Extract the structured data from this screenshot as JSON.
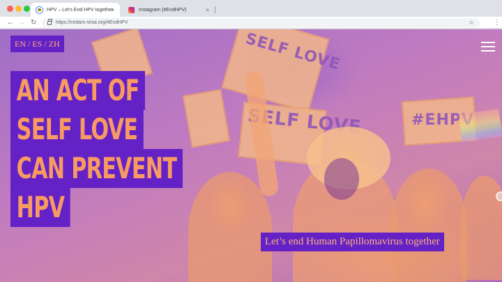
{
  "browser": {
    "tabs": [
      {
        "title": "HPV – Let’s End HPV together",
        "active": true,
        "favicon": "chrome-favicon"
      },
      {
        "title": "Instagram (#EndHPV)",
        "active": false,
        "favicon": "instagram-favicon"
      }
    ],
    "tab_close_glyph": "×",
    "address": "https://cedars-sinai.org/#EndHPV",
    "icons": {
      "back": "←",
      "forward": "→",
      "reload": "↻",
      "star": "☆",
      "menu": "⋮"
    }
  },
  "page": {
    "language_switcher": "EN / ES / ZH",
    "headline_lines": [
      "AN ACT OF",
      "SELF LOVE",
      "CAN PREVENT",
      "HPV"
    ],
    "tagline": "Let’s end Human Papillomavirus together",
    "photo_signs": [
      "SELF LOVE",
      "SELF LOVE",
      "#EHPV"
    ],
    "colors": {
      "accent_purple": "#6321c6",
      "accent_orange": "#f79a63"
    }
  }
}
